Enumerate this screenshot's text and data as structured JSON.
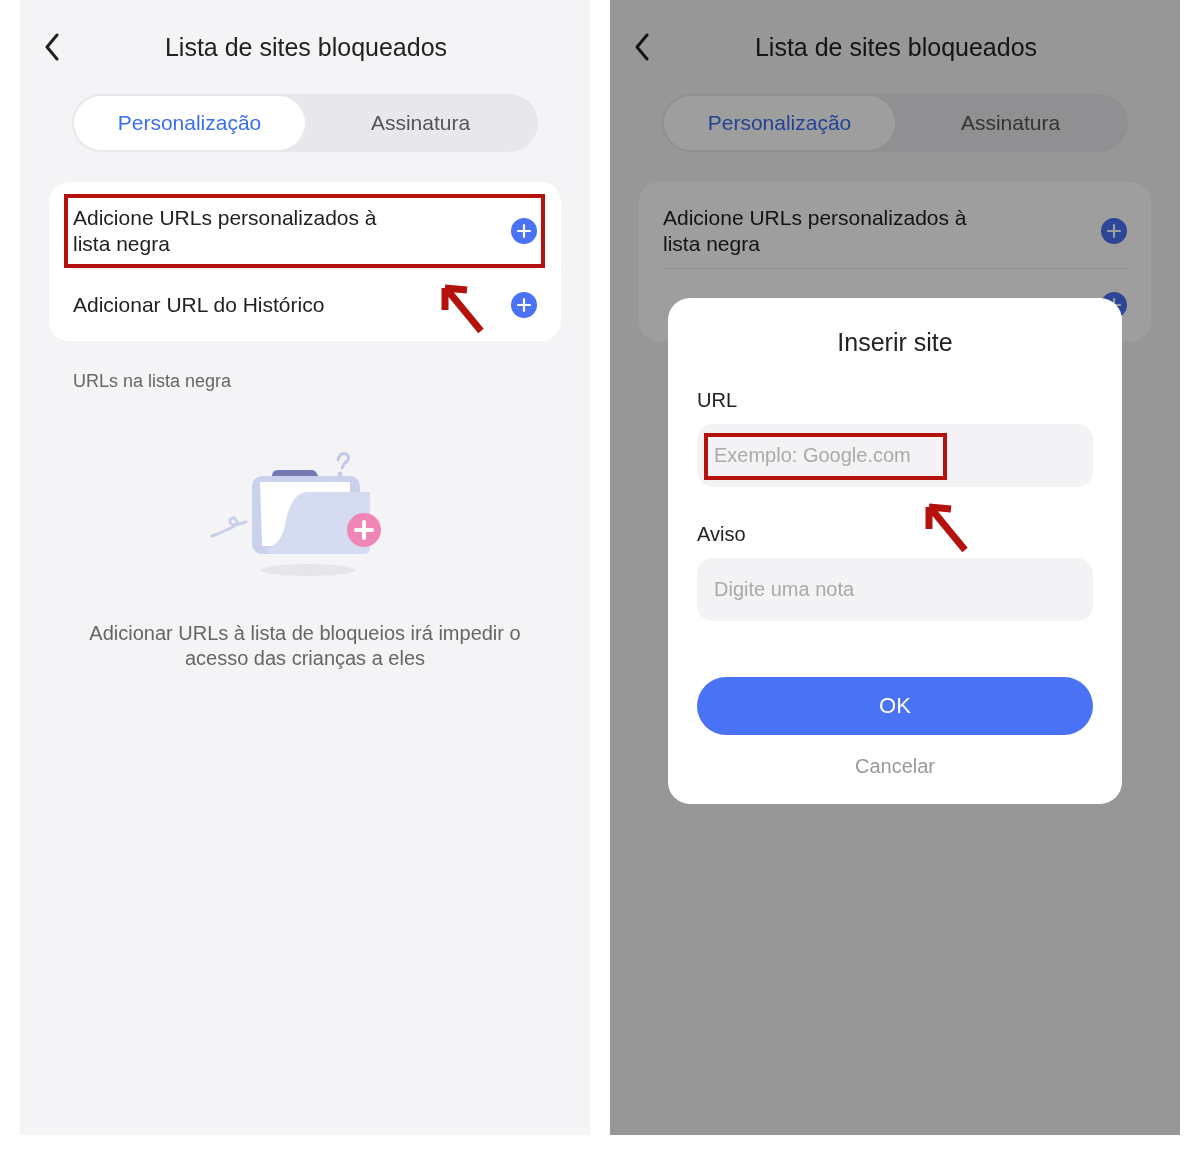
{
  "screens": [
    {
      "dimmed": false,
      "header": {
        "title": "Lista de sites bloqueados"
      },
      "tabs": [
        {
          "label": "Personalização",
          "selected": true
        },
        {
          "label": "Assinatura",
          "selected": false
        }
      ],
      "options": [
        {
          "label": "Adicione URLs personalizados à lista negra",
          "highlighted": true
        },
        {
          "label": "Adicionar URL do Histórico",
          "highlighted": false
        }
      ],
      "section_label": "URLs na lista negra",
      "empty_state": {
        "message": "Adicionar URLs à lista de bloqueios irá impedir o acesso das crianças a eles"
      }
    },
    {
      "dimmed": true,
      "header": {
        "title": "Lista de sites bloqueados"
      },
      "tabs": [
        {
          "label": "Personalização",
          "selected": true
        },
        {
          "label": "Assinatura",
          "selected": false
        }
      ],
      "options": [
        {
          "label": "Adicione URLs personalizados à lista negra",
          "highlighted": false
        },
        {
          "highlighted": false
        }
      ],
      "dialog": {
        "title": "Inserir site",
        "fields": [
          {
            "label": "URL",
            "placeholder": "Exemplo: Google.com",
            "highlighted": true
          },
          {
            "label": "Aviso",
            "placeholder": "Digite uma nota",
            "highlighted": false
          }
        ],
        "confirm": "OK",
        "cancel": "Cancelar"
      }
    }
  ]
}
